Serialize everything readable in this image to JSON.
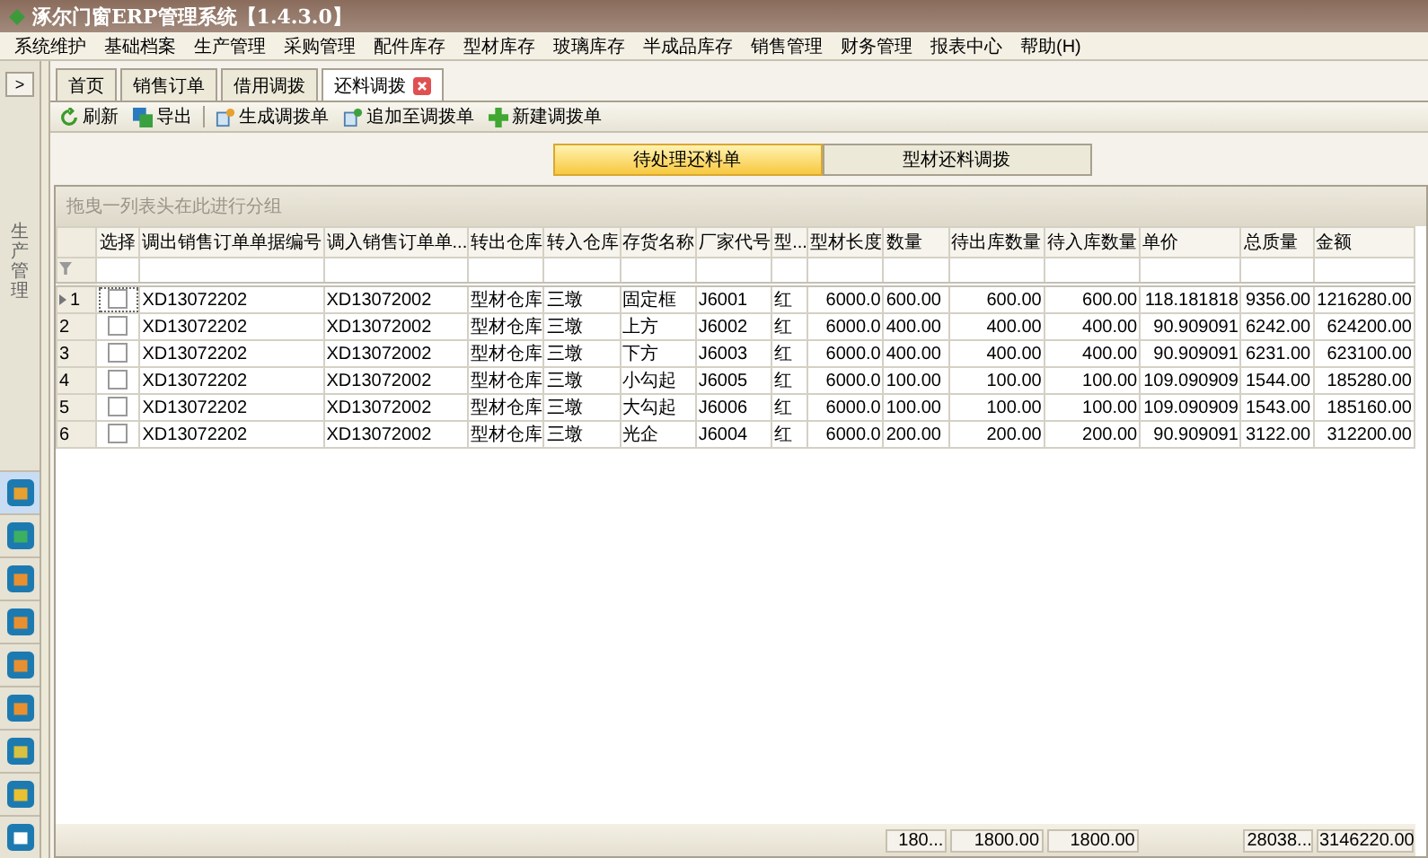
{
  "window": {
    "title": "涿尔门窗ERP管理系统【1.4.3.0】"
  },
  "menu": [
    "系统维护",
    "基础档案",
    "生产管理",
    "采购管理",
    "配件库存",
    "型材库存",
    "玻璃库存",
    "半成品库存",
    "销售管理",
    "财务管理",
    "报表中心",
    "帮助(H)"
  ],
  "sidebar": {
    "expand_label": ">",
    "section_label": "生产管理",
    "items": [
      {
        "selected": true
      },
      {
        "selected": false
      },
      {
        "selected": false
      },
      {
        "selected": false
      },
      {
        "selected": false
      },
      {
        "selected": false
      },
      {
        "selected": false
      },
      {
        "selected": false
      },
      {
        "selected": false
      }
    ]
  },
  "tabs": [
    {
      "label": "首页",
      "selected": false,
      "closable": false
    },
    {
      "label": "销售订单",
      "selected": false,
      "closable": false
    },
    {
      "label": "借用调拨",
      "selected": false,
      "closable": false
    },
    {
      "label": "还料调拨",
      "selected": true,
      "closable": true
    }
  ],
  "toolbar": [
    {
      "label": "刷新",
      "kind": "refresh"
    },
    {
      "label": "导出",
      "kind": "export"
    },
    {
      "label": "生成调拨单",
      "kind": "generate"
    },
    {
      "label": "追加至调拨单",
      "kind": "append"
    },
    {
      "label": "新建调拨单",
      "kind": "new"
    }
  ],
  "view_switch": [
    {
      "label": "待处理还料单",
      "selected": true
    },
    {
      "label": "型材还料调拨",
      "selected": false
    }
  ],
  "group_panel": {
    "hint": "拖曳一列表头在此进行分组"
  },
  "table": {
    "select_column": {
      "label": "选择"
    },
    "columns": [
      {
        "label": "调出销售订单单据编号",
        "kind": "text"
      },
      {
        "label": "调入销售订单单...",
        "kind": "text"
      },
      {
        "label": "转出仓库",
        "kind": "text"
      },
      {
        "label": "转入仓库",
        "kind": "text"
      },
      {
        "label": "存货名称",
        "kind": "text"
      },
      {
        "label": "厂家代号",
        "kind": "text"
      },
      {
        "label": "型...",
        "kind": "text"
      },
      {
        "label": "型材长度",
        "kind": "number"
      },
      {
        "label": "数量",
        "kind": "text",
        "total": "180..."
      },
      {
        "label": "待出库数量",
        "kind": "number",
        "total": "1800.00"
      },
      {
        "label": "待入库数量",
        "kind": "number",
        "total": "1800.00"
      },
      {
        "label": "单价",
        "kind": "number"
      },
      {
        "label": "总质量",
        "kind": "number",
        "total": "28038..."
      },
      {
        "label": "金额",
        "kind": "number",
        "total": "3146220.00"
      }
    ],
    "rows": [
      {
        "index": "1",
        "current": true,
        "checked": false,
        "cells": [
          "XD13072202",
          "XD13072002",
          "型材仓库",
          "三墩",
          "固定框",
          "J6001",
          "红",
          "6000.0",
          "600.00",
          "600.00",
          "600.00",
          "118.181818",
          "9356.00",
          "1216280.00"
        ]
      },
      {
        "index": "2",
        "current": false,
        "checked": false,
        "cells": [
          "XD13072202",
          "XD13072002",
          "型材仓库",
          "三墩",
          "上方",
          "J6002",
          "红",
          "6000.0",
          "400.00",
          "400.00",
          "400.00",
          "90.909091",
          "6242.00",
          "624200.00"
        ]
      },
      {
        "index": "3",
        "current": false,
        "checked": false,
        "cells": [
          "XD13072202",
          "XD13072002",
          "型材仓库",
          "三墩",
          "下方",
          "J6003",
          "红",
          "6000.0",
          "400.00",
          "400.00",
          "400.00",
          "90.909091",
          "6231.00",
          "623100.00"
        ]
      },
      {
        "index": "4",
        "current": false,
        "checked": false,
        "cells": [
          "XD13072202",
          "XD13072002",
          "型材仓库",
          "三墩",
          "小勾起",
          "J6005",
          "红",
          "6000.0",
          "100.00",
          "100.00",
          "100.00",
          "109.090909",
          "1544.00",
          "185280.00"
        ]
      },
      {
        "index": "5",
        "current": false,
        "checked": false,
        "cells": [
          "XD13072202",
          "XD13072002",
          "型材仓库",
          "三墩",
          "大勾起",
          "J6006",
          "红",
          "6000.0",
          "100.00",
          "100.00",
          "100.00",
          "109.090909",
          "1543.00",
          "185160.00"
        ]
      },
      {
        "index": "6",
        "current": false,
        "checked": false,
        "cells": [
          "XD13072202",
          "XD13072002",
          "型材仓库",
          "三墩",
          "光企",
          "J6004",
          "红",
          "6000.0",
          "200.00",
          "200.00",
          "200.00",
          "90.909091",
          "3122.00",
          "312200.00"
        ]
      }
    ]
  }
}
